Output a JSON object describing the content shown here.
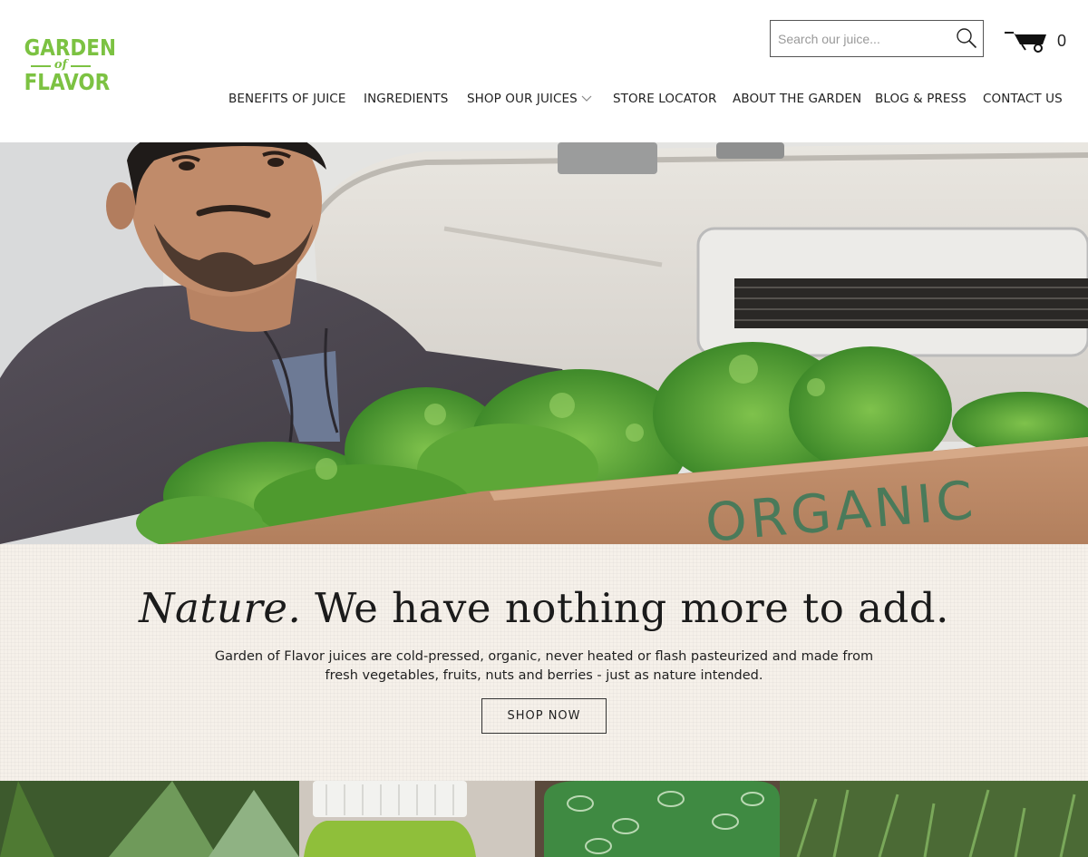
{
  "brand": {
    "logo_line1": "GARDEN",
    "logo_line2": "of",
    "logo_line3": "FLAVOR",
    "green": "#7cc242"
  },
  "search": {
    "placeholder": "Search our juice...",
    "icon": "search-icon"
  },
  "cart": {
    "icon": "wheelbarrow-cart-icon",
    "count": "0"
  },
  "nav": {
    "items": [
      {
        "label": "BENEFITS OF JUICE"
      },
      {
        "label": "INGREDIENTS"
      },
      {
        "label": "SHOP OUR JUICES",
        "has_dropdown": true
      },
      {
        "label": "STORE LOCATOR"
      },
      {
        "label": "ABOUT THE GARDEN"
      },
      {
        "label": "BLOG & PRESS"
      },
      {
        "label": "CONTACT US"
      }
    ]
  },
  "hero": {
    "box_text": "ORGANIC"
  },
  "banner": {
    "headline_italic": "Nature.",
    "headline_rest": " We have nothing more to add.",
    "body_line1": "Garden of Flavor juices are cold-pressed, organic, never heated or flash pasteurized and made from",
    "body_line2": "fresh vegetables, fruits, nuts and berries - just as nature intended.",
    "cta": "SHOP NOW",
    "background": "#f6f1ea"
  }
}
